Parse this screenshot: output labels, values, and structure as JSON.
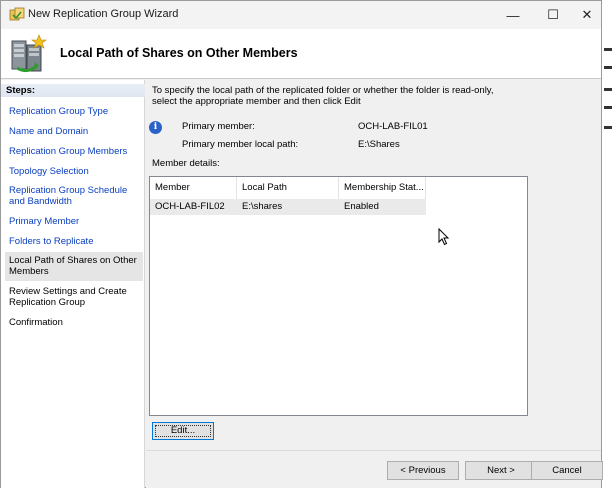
{
  "window": {
    "title": "New Replication Group Wizard",
    "controls": {
      "minimize": "—",
      "maximize": "☐",
      "close": "✕"
    }
  },
  "header": {
    "title": "Local Path of Shares on Other Members",
    "icon": "replication-server-icon"
  },
  "steps": {
    "heading": "Steps:",
    "items": [
      {
        "label": "Replication Group Type",
        "state": "link"
      },
      {
        "label": "Name and Domain",
        "state": "link"
      },
      {
        "label": "Replication Group Members",
        "state": "link"
      },
      {
        "label": "Topology Selection",
        "state": "link"
      },
      {
        "label": "Replication Group Schedule and Bandwidth",
        "state": "link"
      },
      {
        "label": "Primary Member",
        "state": "link"
      },
      {
        "label": "Folders to Replicate",
        "state": "link"
      },
      {
        "label": "Local Path of Shares on Other Members",
        "state": "current"
      },
      {
        "label": "Review Settings and Create Replication Group",
        "state": "plain"
      },
      {
        "label": "Confirmation",
        "state": "plain"
      }
    ]
  },
  "main": {
    "intro": "To specify the local path of the replicated folder or whether the folder is read-only, select the appropriate member and then click Edit",
    "primary_member_label": "Primary member:",
    "primary_member_value": "OCH-LAB-FIL01",
    "primary_path_label": "Primary member local path:",
    "primary_path_value": "E:\\Shares",
    "member_details_label": "Member details:",
    "table": {
      "columns": [
        "Member",
        "Local Path",
        "Membership Stat..."
      ],
      "rows": [
        [
          "OCH-LAB-FIL02",
          "E:\\shares",
          "Enabled"
        ]
      ]
    },
    "edit_button": "Edit..."
  },
  "footer": {
    "previous": "< Previous",
    "next": "Next >",
    "cancel": "Cancel"
  },
  "colors": {
    "link": "#0a3fbf",
    "selection": "#eaeaea",
    "focus_border": "#0078d7"
  }
}
